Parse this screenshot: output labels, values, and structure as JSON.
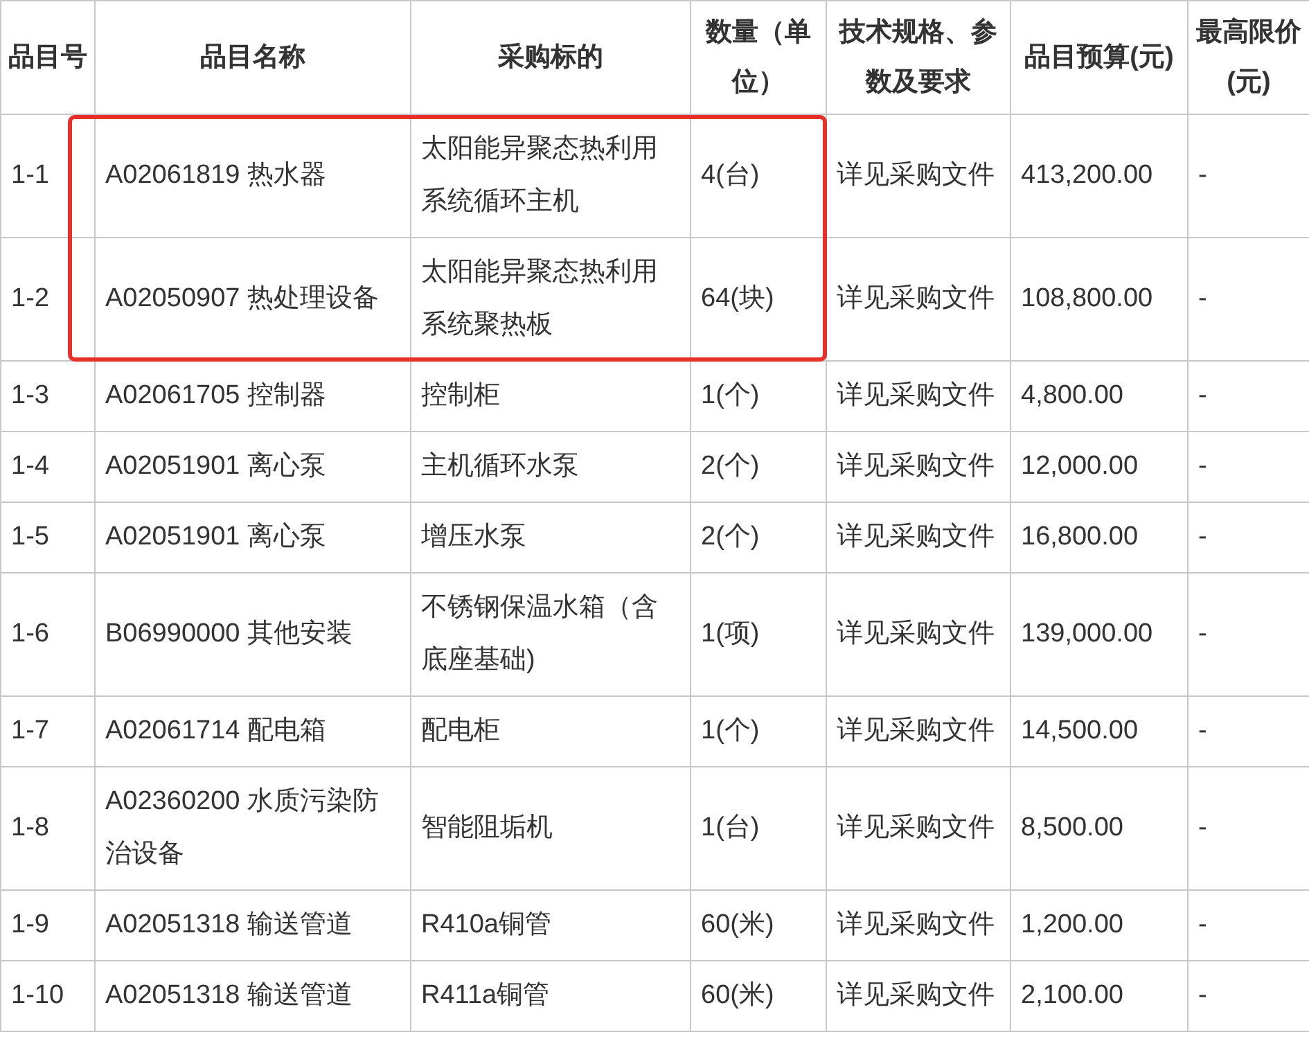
{
  "table": {
    "columns": [
      "品目号",
      "品目名称",
      "采购标的",
      "数量（单位）",
      "技术规格、参数及要求",
      "品目预算(元)",
      "最高限价(元)"
    ],
    "rows": [
      {
        "cells": [
          "1-1",
          "A02061819 热水器",
          "太阳能异聚态热利用系统循环主机",
          "4(台)",
          "详见采购文件",
          "413,200.00",
          "-"
        ],
        "highlighted": true
      },
      {
        "cells": [
          "1-2",
          "A02050907 热处理设备",
          "太阳能异聚态热利用系统聚热板",
          "64(块)",
          "详见采购文件",
          "108,800.00",
          "-"
        ],
        "highlighted": true
      },
      {
        "cells": [
          "1-3",
          "A02061705 控制器",
          "控制柜",
          "1(个)",
          "详见采购文件",
          "4,800.00",
          "-"
        ],
        "highlighted": false
      },
      {
        "cells": [
          "1-4",
          "A02051901 离心泵",
          "主机循环水泵",
          "2(个)",
          "详见采购文件",
          "12,000.00",
          "-"
        ],
        "highlighted": false
      },
      {
        "cells": [
          "1-5",
          "A02051901 离心泵",
          "增压水泵",
          "2(个)",
          "详见采购文件",
          "16,800.00",
          "-"
        ],
        "highlighted": false
      },
      {
        "cells": [
          "1-6",
          "B06990000 其他安装",
          "不锈钢保温水箱（含底座基础)",
          "1(项)",
          "详见采购文件",
          "139,000.00",
          "-"
        ],
        "highlighted": false
      },
      {
        "cells": [
          "1-7",
          "A02061714 配电箱",
          "配电柜",
          "1(个)",
          "详见采购文件",
          "14,500.00",
          "-"
        ],
        "highlighted": false
      },
      {
        "cells": [
          "1-8",
          "A02360200 水质污染防治设备",
          "智能阻垢机",
          "1(台)",
          "详见采购文件",
          "8,500.00",
          "-"
        ],
        "highlighted": false
      },
      {
        "cells": [
          "1-9",
          "A02051318 输送管道",
          "R410a铜管",
          "60(米)",
          "详见采购文件",
          "1,200.00",
          "-"
        ],
        "highlighted": false
      },
      {
        "cells": [
          "1-10",
          "A02051318 输送管道",
          "R411a铜管",
          "60(米)",
          "详见采购文件",
          "2,100.00",
          "-"
        ],
        "highlighted": false
      }
    ]
  }
}
